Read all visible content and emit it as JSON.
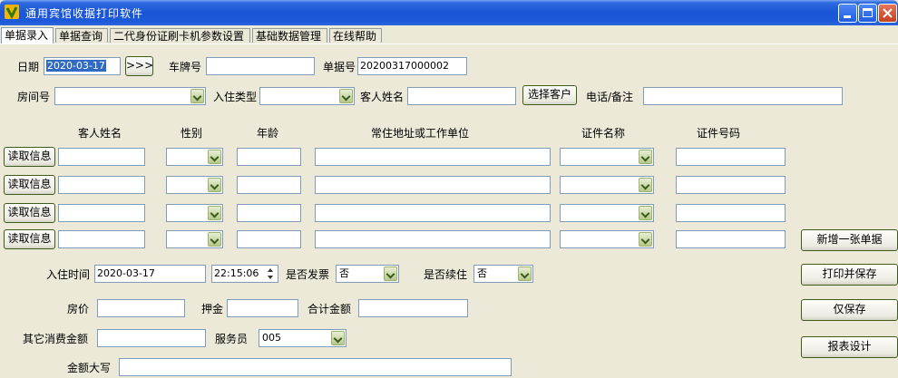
{
  "window": {
    "title": "通用宾馆收据打印软件"
  },
  "tabs": [
    "单据录入",
    "单据查询",
    "二代身份证刷卡机参数设置",
    "基础数据管理",
    "在线帮助"
  ],
  "header": {
    "date_label": "日期",
    "date_value": "2020-03-17",
    "date_button": ">>>",
    "plate_label": "车牌号",
    "plate_value": "",
    "receipt_no_label": "单据号",
    "receipt_no_value": "20200317000002",
    "room_label": "房间号",
    "room_value": "",
    "checkin_type_label": "入住类型",
    "checkin_type_value": "",
    "guest_name_label": "客人姓名",
    "guest_name_value": "",
    "select_customer_button": "选择客户",
    "phone_label": "电话/备注",
    "phone_value": ""
  },
  "guest_table": {
    "columns": [
      "客人姓名",
      "性别",
      "年龄",
      "常住地址或工作单位",
      "证件名称",
      "证件号码"
    ],
    "read_button": "读取信息",
    "rows": [
      {
        "name": "",
        "gender": "",
        "age": "",
        "address": "",
        "id_type": "",
        "id_no": ""
      },
      {
        "name": "",
        "gender": "",
        "age": "",
        "address": "",
        "id_type": "",
        "id_no": ""
      },
      {
        "name": "",
        "gender": "",
        "age": "",
        "address": "",
        "id_type": "",
        "id_no": ""
      },
      {
        "name": "",
        "gender": "",
        "age": "",
        "address": "",
        "id_type": "",
        "id_no": ""
      }
    ]
  },
  "footer": {
    "checkin_time_label": "入住时间",
    "checkin_date": "2020-03-17",
    "checkin_time": "22:15:06",
    "invoice_label": "是否发票",
    "invoice_value": "否",
    "continue_label": "是否续住",
    "continue_value": "否",
    "price_label": "房价",
    "price_value": "",
    "deposit_label": "押金",
    "deposit_value": "",
    "total_label": "合计金额",
    "total_value": "",
    "other_label": "其它消费金额",
    "other_value": "",
    "staff_label": "服务员",
    "staff_value": "005",
    "capital_label": "金额大写",
    "capital_value": ""
  },
  "actions": {
    "new": "新增一张单据",
    "print_save": "打印并保存",
    "save_only": "仅保存",
    "report": "报表设计"
  }
}
